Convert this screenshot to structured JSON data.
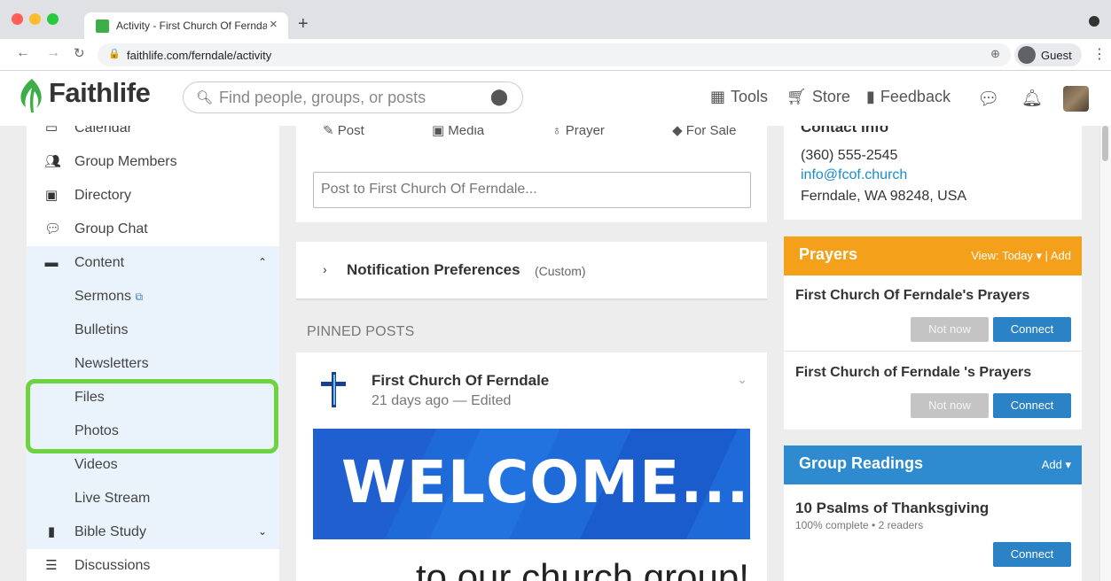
{
  "browser": {
    "tab_title": "Activity - First Church Of Ferndale",
    "new_tab": "+",
    "url": "faithlife.com/ferndale/activity",
    "profile_label": "Guest"
  },
  "header": {
    "logo": "Faithlife",
    "search_placeholder": "Find people, groups, or posts",
    "nav": {
      "tools": "Tools",
      "store": "Store",
      "feedback": "Feedback"
    }
  },
  "sidebar": {
    "calendar": "Calendar",
    "group_members": "Group Members",
    "directory": "Directory",
    "group_chat": "Group Chat",
    "content": "Content",
    "sub_items": {
      "sermons": "Sermons",
      "bulletins": "Bulletins",
      "newsletters": "Newsletters",
      "files": "Files",
      "photos": "Photos",
      "videos": "Videos",
      "live_stream": "Live Stream"
    },
    "bible_study": "Bible Study",
    "discussions": "Discussions"
  },
  "composer": {
    "tabs": {
      "post": "Post",
      "media": "Media",
      "prayer": "Prayer",
      "for_sale": "For Sale"
    },
    "input_placeholder": "Post to First Church Of Ferndale..."
  },
  "notifications": {
    "title": "Notification Preferences",
    "setting": "(Custom)"
  },
  "pinned": {
    "section_label": "PINNED POSTS",
    "author": "First Church Of Ferndale",
    "meta": "21 days ago — Edited",
    "banner_text": "WELCOME...",
    "body_text": "...to our church group!"
  },
  "contact": {
    "title": "Contact Info",
    "phone": "(360) 555-2545",
    "email": "info@fcof.church",
    "address": "Ferndale, WA 98248, USA"
  },
  "prayers": {
    "title": "Prayers",
    "view_label": "View: Today ▾ | Add",
    "items": [
      {
        "name": "First Church Of Ferndale's Prayers",
        "not_now": "Not now",
        "connect": "Connect"
      },
      {
        "name": "First Church of Ferndale 's Prayers",
        "not_now": "Not now",
        "connect": "Connect"
      }
    ]
  },
  "readings": {
    "title": "Group Readings",
    "add_label": "Add ▾",
    "item_title": "10 Psalms of Thanksgiving",
    "item_meta": "100% complete • 2 readers",
    "connect": "Connect"
  },
  "colors": {
    "prayers_header": "#f5a01a",
    "readings_header": "#2e8bd0",
    "highlight": "#6dd33e",
    "brand_green": "#3fae49"
  }
}
